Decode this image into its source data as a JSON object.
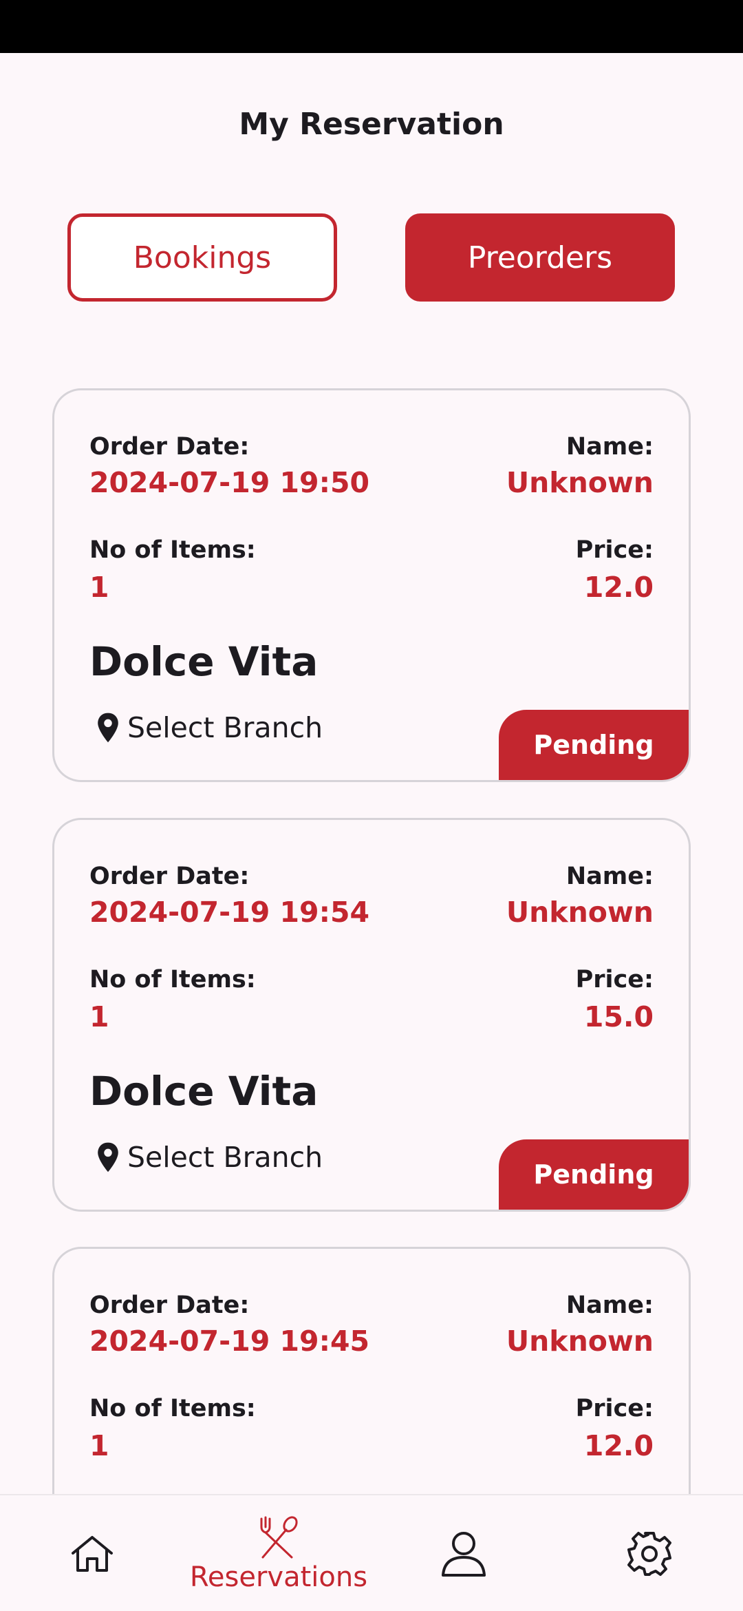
{
  "header": {
    "title": "My Reservation"
  },
  "tabs": {
    "bookings_label": "Bookings",
    "preorders_label": "Preorders",
    "selected": "Preorders"
  },
  "labels": {
    "order_date": "Order Date:",
    "name": "Name:",
    "no_of_items": "No of Items:",
    "price": "Price:"
  },
  "orders": [
    {
      "order_date": "2024-07-19 19:50",
      "name": "Unknown",
      "items": "1",
      "price": "12.0",
      "restaurant": "Dolce Vita",
      "branch": "Select Branch",
      "status": "Pending"
    },
    {
      "order_date": "2024-07-19 19:54",
      "name": "Unknown",
      "items": "1",
      "price": "15.0",
      "restaurant": "Dolce Vita",
      "branch": "Select Branch",
      "status": "Pending"
    },
    {
      "order_date": "2024-07-19 19:45",
      "name": "Unknown",
      "items": "1",
      "price": "12.0"
    }
  ],
  "bottom_nav": {
    "items": [
      {
        "icon": "home-icon"
      },
      {
        "icon": "fork-spoon-icon",
        "label": "Reservations",
        "active": true
      },
      {
        "icon": "person-icon"
      },
      {
        "icon": "gear-icon"
      }
    ]
  },
  "colors": {
    "accent": "#c3262f",
    "background": "#fdf7fa",
    "text": "#1d1b20"
  }
}
